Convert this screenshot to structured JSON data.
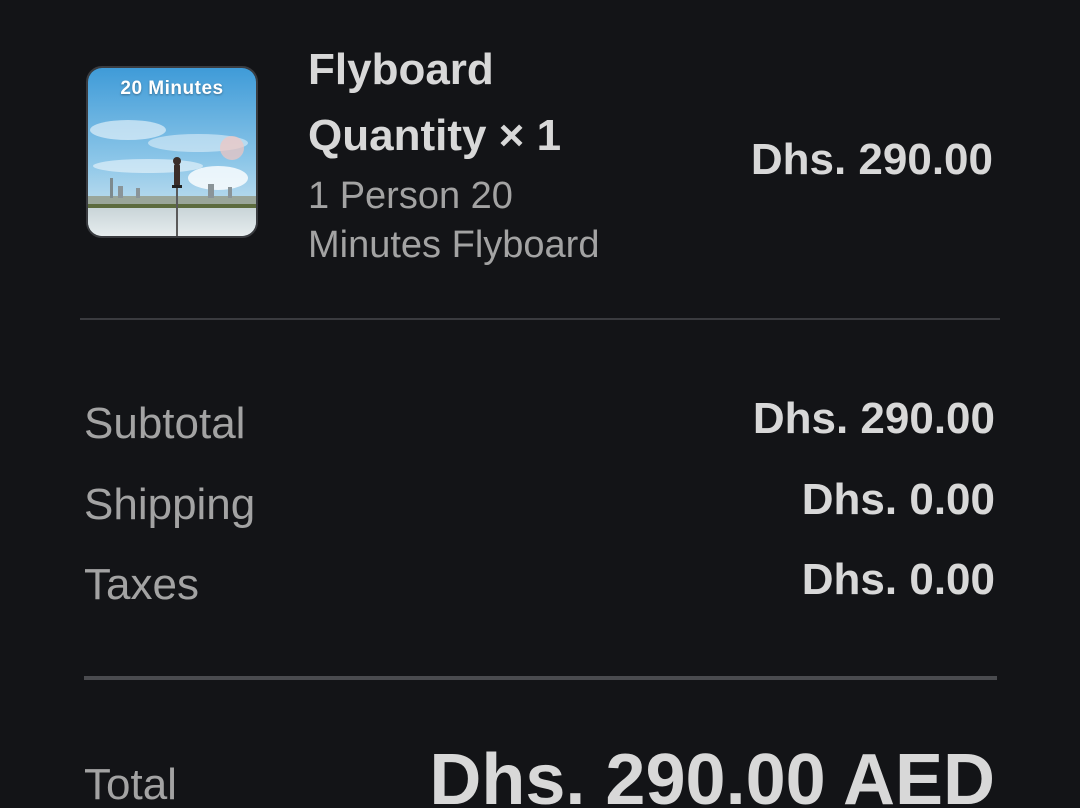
{
  "product": {
    "image_caption": "20 Minutes",
    "name": "Flyboard",
    "quantity": "Quantity × 1",
    "variant": "1 Person 20 Minutes Flyboard",
    "price": "Dhs. 290.00"
  },
  "summary": {
    "subtotal_label": "Subtotal",
    "subtotal_value": "Dhs. 290.00",
    "shipping_label": "Shipping",
    "shipping_value": "Dhs. 0.00",
    "taxes_label": "Taxes",
    "taxes_value": "Dhs. 0.00"
  },
  "total": {
    "label": "Total",
    "value": "Dhs. 290.00 AED"
  },
  "colors": {
    "background": "#131417",
    "primary_text": "#d8d8d8",
    "secondary_text": "#a3a3a3",
    "divider": "#3a3b3f"
  }
}
